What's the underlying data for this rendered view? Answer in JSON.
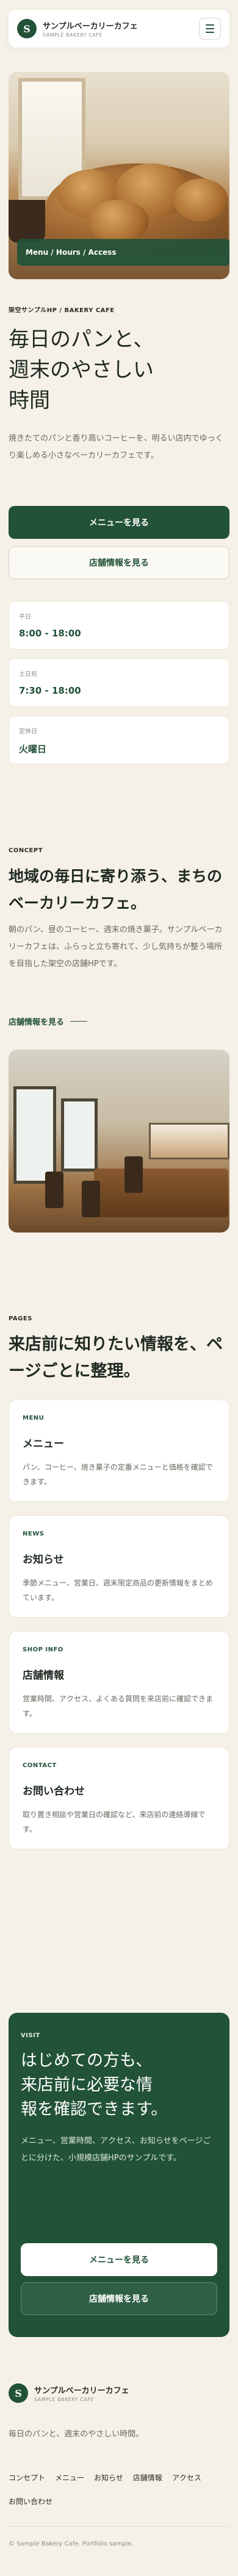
{
  "header": {
    "logo_letter": "S",
    "brand_name": "サンプルベーカリーカフェ",
    "brand_sub": "SAMPLE BAKERY CAFE",
    "menu_icon": "hamburger-icon"
  },
  "hero": {
    "caption": "Menu / Hours / Access",
    "eyebrow": "架空サンプルHP / BAKERY CAFE",
    "title": "毎日のパンと、\n週末のやさしい\n時間",
    "description": "焼きたてのパンと香り高いコーヒーを、明るい店内でゆっくり楽しめる小さなベーカリーカフェです。",
    "primary_button": "メニューを見る",
    "secondary_button": "店舗情報を見る"
  },
  "info": [
    {
      "label": "平日",
      "value": "8:00 - 18:00"
    },
    {
      "label": "土日祝",
      "value": "7:30 - 18:00"
    },
    {
      "label": "定休日",
      "value": "火曜日"
    }
  ],
  "concept": {
    "eyebrow": "CONCEPT",
    "title": "地域の毎日に寄り添う、まちのベーカリーカフェ。",
    "description": "朝のパン、昼のコーヒー、週末の焼き菓子。サンプルベーカリーカフェは、ふらっと立ち寄れて、少し気持ちが整う場所を目指した架空の店舗HPです。",
    "link": "店舗情報を見る"
  },
  "pages": {
    "eyebrow": "PAGES",
    "title": "来店前に知りたい情報を、ページごとに整理。",
    "cards": [
      {
        "tag": "MENU",
        "title": "メニュー",
        "desc": "パン、コーヒー、焼き菓子の定番メニューと価格を確認できます。"
      },
      {
        "tag": "NEWS",
        "title": "お知らせ",
        "desc": "季節メニュー、営業日、週末限定商品の更新情報をまとめています。"
      },
      {
        "tag": "SHOP INFO",
        "title": "店舗情報",
        "desc": "営業時間、アクセス、よくある質問を来店前に確認できます。"
      },
      {
        "tag": "CONTACT",
        "title": "お問い合わせ",
        "desc": "取り置き相談や営業日の確認など、来店前の連絡導線です。"
      }
    ]
  },
  "visit": {
    "tag": "VISIT",
    "title": "はじめての方も、\n来店前に必要な情\n報を確認できます。",
    "description": "メニュー、営業時間、アクセス、お知らせをページごとに分けた、小規模店舗HPのサンプルです。",
    "primary_button": "メニューを見る",
    "secondary_button": "店舗情報を見る"
  },
  "footer": {
    "brand_name": "サンプルベーカリーカフェ",
    "brand_sub": "SAMPLE BAKERY CAFE",
    "tagline": "毎日のパンと、週末のやさしい時間。",
    "nav": [
      "コンセプト",
      "メニュー",
      "お知らせ",
      "店舗情報",
      "アクセス",
      "お問い合わせ"
    ],
    "copyright": "© Sample Bakery Cafe. Portfolio sample."
  },
  "colors": {
    "accent": "#225238",
    "background": "#f6f1e8",
    "card": "#ffffff"
  }
}
